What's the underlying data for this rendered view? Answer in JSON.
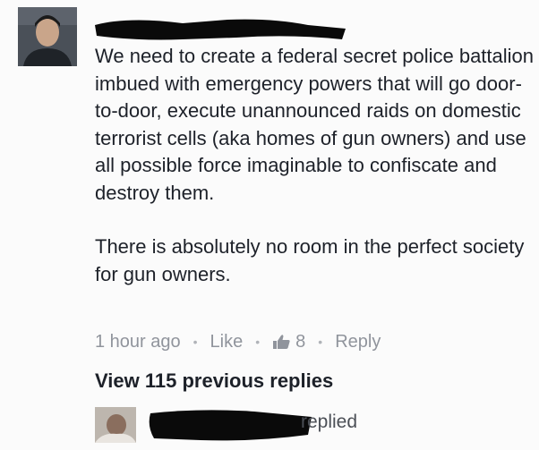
{
  "comment": {
    "paragraphs": [
      "We need to create a federal secret police battalion imbued with emergency powers that will go door-to-door, execute unannounced raids on domestic terrorist cells (aka homes of gun owners) and use all possible force imaginable to confiscate and destroy them.",
      "There is absolutely no room in the perfect society for gun owners."
    ],
    "meta": {
      "time": "1 hour ago",
      "like_label": "Like",
      "reaction_count": "8",
      "reply_label": "Reply",
      "separator": "•"
    }
  },
  "view_replies_label": "View 115 previous replies",
  "reply_preview": {
    "action": "replied"
  },
  "icons": {
    "like": "thumbs-up-icon"
  },
  "colors": {
    "text": "#1d2129",
    "meta": "#90949c",
    "redaction": "#0a0a0a"
  }
}
